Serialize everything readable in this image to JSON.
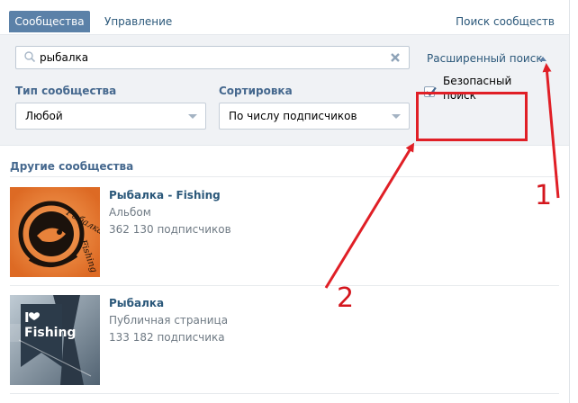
{
  "tabs": {
    "active": "Сообщества",
    "second": "Управление",
    "right": "Поиск сообществ"
  },
  "search": {
    "value": "рыбалка",
    "advanced_label": "Расширенный поиск"
  },
  "filters": {
    "type_label": "Тип сообщества",
    "type_value": "Любой",
    "sort_label": "Сортировка",
    "sort_value": "По числу подписчиков",
    "safe_label": "Безопасный поиск",
    "safe_checked": true
  },
  "results": {
    "section_title": "Другие сообщества",
    "items": [
      {
        "title": "Рыбалка - Fishing",
        "type": "Альбом",
        "subscribers": "362 130 подписчиков",
        "thumb_text": "Рыбалка Fishing"
      },
      {
        "title": "Рыбалка",
        "type": "Публичная страница",
        "subscribers": "133 182 подписчика",
        "thumb_text": "I Fishing"
      }
    ]
  },
  "annotations": {
    "label_1": "1",
    "label_2": "2",
    "color": "#e01f26"
  },
  "colors": {
    "accent": "#5b81a8",
    "link": "#2b587a",
    "panel": "#f0f2f5"
  }
}
